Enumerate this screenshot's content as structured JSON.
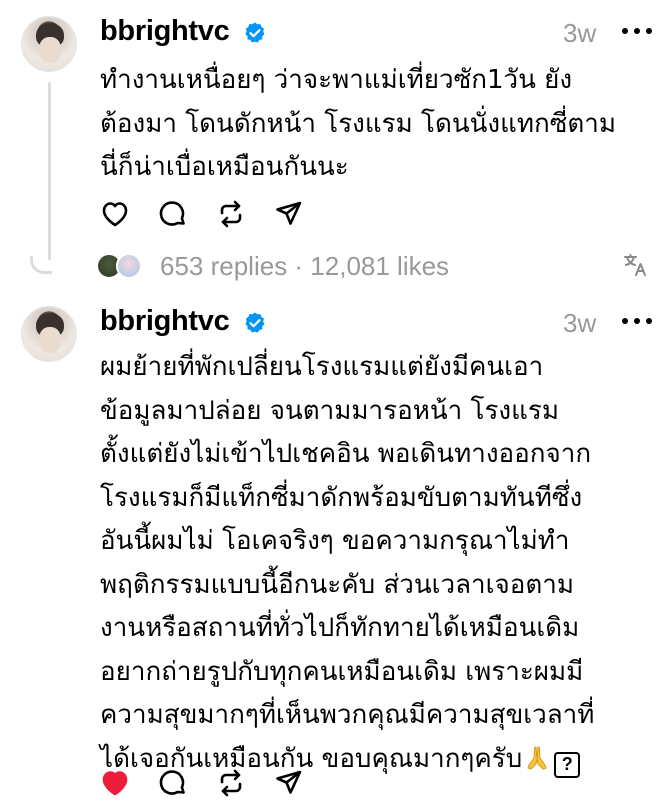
{
  "colors": {
    "like_active": "#ed1c3b",
    "meta_gray": "#999999",
    "verified_blue": "#0095f6",
    "thread_line": "#dcdcdc"
  },
  "posts": [
    {
      "username": "bbrightvc",
      "time": "3w",
      "lines": [
        "ทำงานเหนื่อยๆ ว่าจะพาแม่เที่ยวซัก1วัน ยัง",
        "ต้องมา โดนดักหน้า โรงแรม โดนนั่งแทกซี่ตาม",
        "นี่ก็น่าเบื่อเหมือนกันนะ"
      ],
      "liked": false,
      "stats": "653 replies · 12,081 likes"
    },
    {
      "username": "bbrightvc",
      "time": "3w",
      "lines": [
        "ผมย้ายที่พักเปลี่ยนโรงแรมแต่ยังมีคนเอา",
        "ข้อมูลมาปล่อย จนตามมารอหน้า โรงแรม",
        "ตั้งแต่ยังไม่เข้าไปเชคอิน พอเดินทางออกจาก",
        "โรงแรมก็มีแท็กซี่มาดักพร้อมขับตามทันทีซึ่ง",
        "อันนี้ผมไม่ โอเคจริงๆ ขอความกรุณาไม่ทำ",
        "พฤติกรรมแบบนี้อีกนะคับ ส่วนเวลาเจอตาม",
        "งานหรือสถานที่ทั่วไปก็ทักทายได้เหมือนเดิม",
        "อยากถ่ายรูปกับทุกคนเหมือนเดิม เพราะผมมี",
        "ความสุขมากๆที่เห็นพวกคุณมีความสุขเวลาที่",
        "ได้เจอกันเหมือนกัน  ขอบคุณมากๆครับ"
      ],
      "end_box": "?",
      "liked": true
    }
  ],
  "icons": {
    "like": "heart-icon",
    "reply": "comment-icon",
    "repost": "repost-icon",
    "share": "share-icon",
    "more": "more-icon",
    "verified": "verified-badge-icon",
    "translate": "translate-icon",
    "emoji": "praying-hands-emoji"
  }
}
